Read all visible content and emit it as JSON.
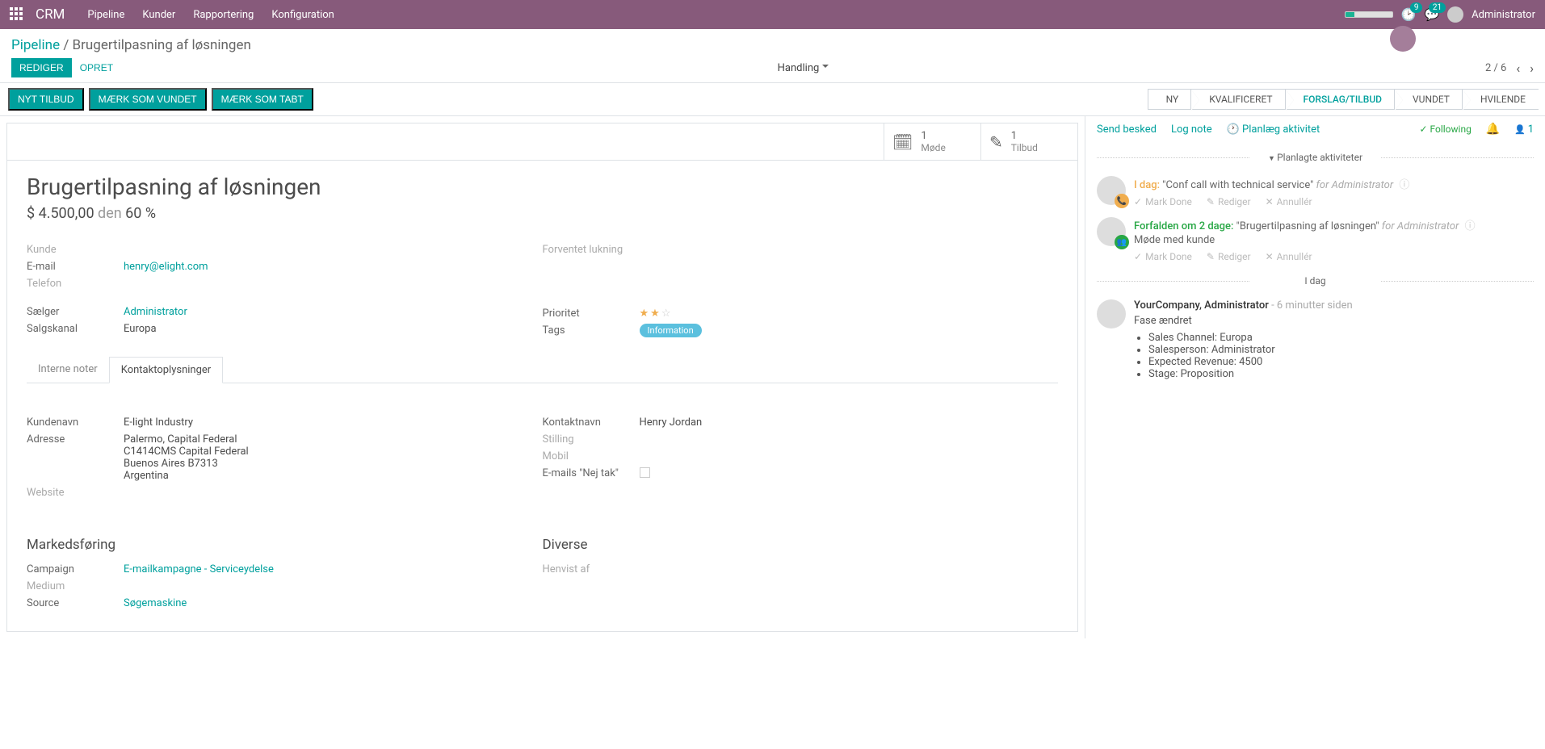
{
  "brand": "CRM",
  "nav": {
    "pipeline": "Pipeline",
    "kunder": "Kunder",
    "rapportering": "Rapportering",
    "konfiguration": "Konfiguration"
  },
  "badges": {
    "activities": "9",
    "messages": "21"
  },
  "user": "Administrator",
  "breadcrumb": {
    "root": "Pipeline",
    "current": "Brugertilpasning af løsningen"
  },
  "buttons": {
    "edit": "REDIGER",
    "create": "OPRET",
    "action": "Handling"
  },
  "pager": {
    "pos": "2 / 6"
  },
  "action_buttons": {
    "new_quote": "NYT TILBUD",
    "mark_won": "MÆRK SOM VUNDET",
    "mark_lost": "MÆRK SOM TABT"
  },
  "stages": {
    "new": "NY",
    "qualified": "KVALIFICERET",
    "proposal": "FORSLAG/TILBUD",
    "won": "VUNDET",
    "dormant": "HVILENDE"
  },
  "statboxes": {
    "meetings_n": "1",
    "meetings_l": "Møde",
    "quotes_n": "1",
    "quotes_l": "Tilbud"
  },
  "title": "Brugertilpasning af løsningen",
  "amount": "$ 4.500,00",
  "den": "den",
  "prob": "60 %",
  "labels": {
    "kunde": "Kunde",
    "email": "E-mail",
    "telefon": "Telefon",
    "forventet": "Forventet lukning",
    "saelger": "Sælger",
    "salgskanal": "Salgskanal",
    "prioritet": "Prioritet",
    "tags": "Tags",
    "kundenavn": "Kundenavn",
    "adresse": "Adresse",
    "website": "Website",
    "kontaktnavn": "Kontaktnavn",
    "stilling": "Stilling",
    "mobil": "Mobil",
    "emails_nej": "E-mails \"Nej tak\"",
    "campaign": "Campaign",
    "medium": "Medium",
    "source": "Source",
    "henvist": "Henvist af"
  },
  "values": {
    "email": "henry@elight.com",
    "saelger": "Administrator",
    "salgskanal": "Europa",
    "tag": "Information",
    "kundenavn": "E-light Industry",
    "addr1": "Palermo, Capital Federal",
    "addr2": "C1414CMS Capital Federal",
    "addr3": "Buenos Aires  B7313",
    "addr4": "Argentina",
    "kontaktnavn": "Henry Jordan",
    "campaign": "E-mailkampagne - Serviceydelse",
    "source": "Søgemaskine"
  },
  "tabs": {
    "interne": "Interne noter",
    "kontakt": "Kontaktoplysninger"
  },
  "sections": {
    "markedsforing": "Markedsføring",
    "diverse": "Diverse"
  },
  "chatter": {
    "send": "Send besked",
    "log": "Log note",
    "plan": "Planlæg aktivitet",
    "following": "Following",
    "followers": "1",
    "planned_hdr": "Planlagte aktiviteter",
    "today_hdr": "I dag",
    "act1_due": "I dag:",
    "act1_title": "\"Conf call with technical service\"",
    "act1_for": "for",
    "act1_user": "Administrator",
    "act2_due": "Forfalden om 2 dage:",
    "act2_title": "\"Brugertilpasning af løsningen\"",
    "act2_for": "for",
    "act2_user": "Administrator",
    "act2_sub": "Møde med kunde",
    "mark_done": "Mark Done",
    "rediger": "Rediger",
    "annuller": "Annullér",
    "msg_author": "YourCompany, Administrator",
    "msg_time": "- 6 minutter siden",
    "msg_line": "Fase ændret",
    "msg_b1": "Sales Channel: Europa",
    "msg_b2": "Salesperson: Administrator",
    "msg_b3": "Expected Revenue: 4500",
    "msg_b4": "Stage: Proposition"
  }
}
